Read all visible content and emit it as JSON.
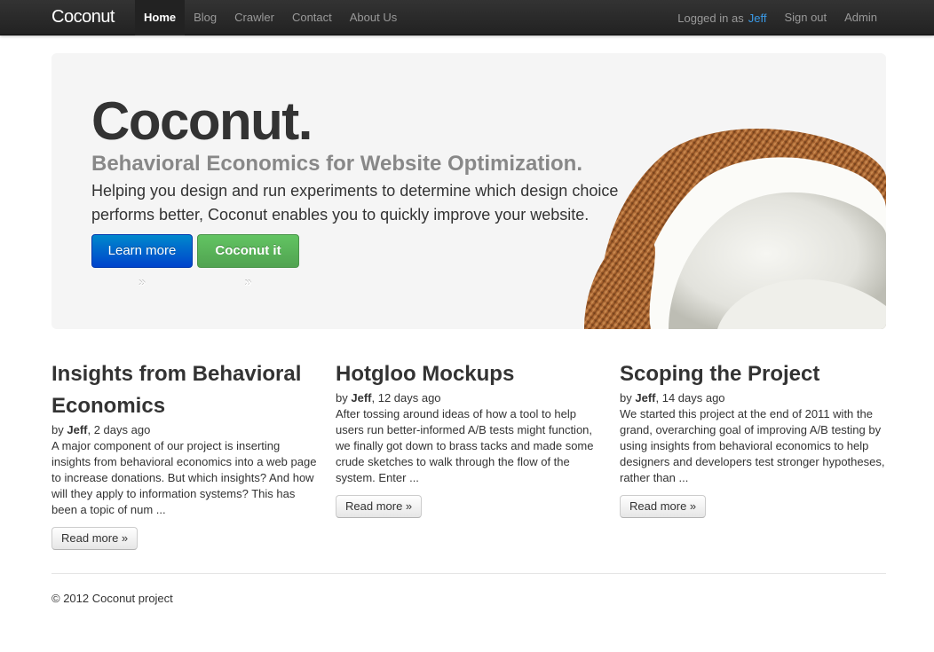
{
  "navbar": {
    "brand": "Coconut",
    "items": [
      {
        "label": "Home",
        "active": true
      },
      {
        "label": "Blog",
        "active": false
      },
      {
        "label": "Crawler",
        "active": false
      },
      {
        "label": "Contact",
        "active": false
      },
      {
        "label": "About Us",
        "active": false
      }
    ],
    "logged_in_text": "Logged in as",
    "user": "Jeff",
    "sign_out": "Sign out",
    "admin": "Admin"
  },
  "hero": {
    "title": "Coconut.",
    "subtitle": "Behavioral Economics for Website Optimization.",
    "description": "Helping you design and run experiments to determine which design choice performs better, Coconut enables you to quickly improve your website.",
    "learn_more": "Learn more »",
    "coconut_it": "Coconut it »",
    "image_icon": "coconut-illustration"
  },
  "posts": [
    {
      "title": "Insights from Behavioral Economics",
      "by": "by",
      "author": "Jeff",
      "time": ", 2 days ago",
      "excerpt": "A major component of our project is inserting insights from behavioral economics into a web page to increase donations. But which insights? And how will they apply to information systems? This has been a topic of num ...",
      "read_more": "Read more »"
    },
    {
      "title": "Hotgloo Mockups",
      "by": "by",
      "author": "Jeff",
      "time": ", 12 days ago",
      "excerpt": "After tossing around ideas of how a tool to help users run better-informed A/B tests might function, we finally got down to brass tacks and made some crude sketches to walk through the flow of the system. Enter ...",
      "read_more": "Read more »"
    },
    {
      "title": "Scoping the Project",
      "by": "by",
      "author": "Jeff",
      "time": ", 14 days ago",
      "excerpt": "We started this project at the end of 2011 with the grand, overarching goal of improving A/B testing by using insights from behavioral economics to help designers and developers test stronger hypotheses, rather than ...",
      "read_more": "Read more »"
    }
  ],
  "footer": {
    "text": "© 2012 Coconut project"
  },
  "colors": {
    "primary": "#0055cc",
    "success": "#5bb75b",
    "link": "#3a9be8",
    "navbar": "#222222"
  }
}
